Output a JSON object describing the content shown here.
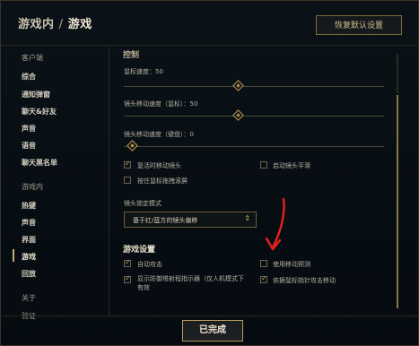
{
  "header": {
    "crumb_parent": "游戏内",
    "crumb_separator": "/",
    "crumb_current": "游戏",
    "reset_label": "恢复默认设置"
  },
  "sidebar": {
    "items": [
      {
        "label": "客户端",
        "kind": "group"
      },
      {
        "label": "综合",
        "kind": "option"
      },
      {
        "label": "通知弹窗",
        "kind": "option"
      },
      {
        "label": "聊天&好友",
        "kind": "option"
      },
      {
        "label": "声音",
        "kind": "option"
      },
      {
        "label": "语音",
        "kind": "option"
      },
      {
        "label": "聊天黑名单",
        "kind": "option"
      },
      {
        "label": "游戏内",
        "kind": "group"
      },
      {
        "label": "热键",
        "kind": "option"
      },
      {
        "label": "声音",
        "kind": "option"
      },
      {
        "label": "界面",
        "kind": "option"
      },
      {
        "label": "游戏",
        "kind": "option",
        "active": true
      },
      {
        "label": "回放",
        "kind": "option"
      },
      {
        "label": "关于",
        "kind": "group"
      },
      {
        "label": "验证",
        "kind": "group"
      }
    ]
  },
  "controls": {
    "section_title": "控制",
    "mouse_speed_label": "鼠标速度：50",
    "mouse_speed_value": 50,
    "cam_mouse_label": "镜头移动速度（鼠标）：50",
    "cam_mouse_value": 50,
    "cam_keyboard_label": "镜头移动速度（键盘）：0",
    "cam_keyboard_value": 0,
    "checkboxes": [
      {
        "label": "复活时移动镜头",
        "checked": true
      },
      {
        "label": "启动镜头平滑",
        "checked": false
      },
      {
        "label": "按住鼠标拖拽滚屏",
        "checked": false
      }
    ],
    "lock_mode_label": "镜头锁定模式",
    "lock_mode_value": "基于红/蓝方的镜头偏移"
  },
  "game_settings": {
    "section_title": "游戏设置",
    "checkboxes": [
      {
        "label": "自动攻击",
        "checked": true
      },
      {
        "label": "使用移动预测",
        "checked": false
      },
      {
        "label": "显示防御塔射程指示器（仅人机模式下有效）",
        "line1": "显示防御塔射程指示器（仅人机模式下",
        "line2": "有效",
        "checked": true
      },
      {
        "label": "依据鼠标指针攻击移动",
        "checked": true
      }
    ]
  },
  "footer": {
    "done_label": "已完成"
  },
  "colors": {
    "gold": "#c8aa6e",
    "annotation_red": "#e0201e"
  }
}
